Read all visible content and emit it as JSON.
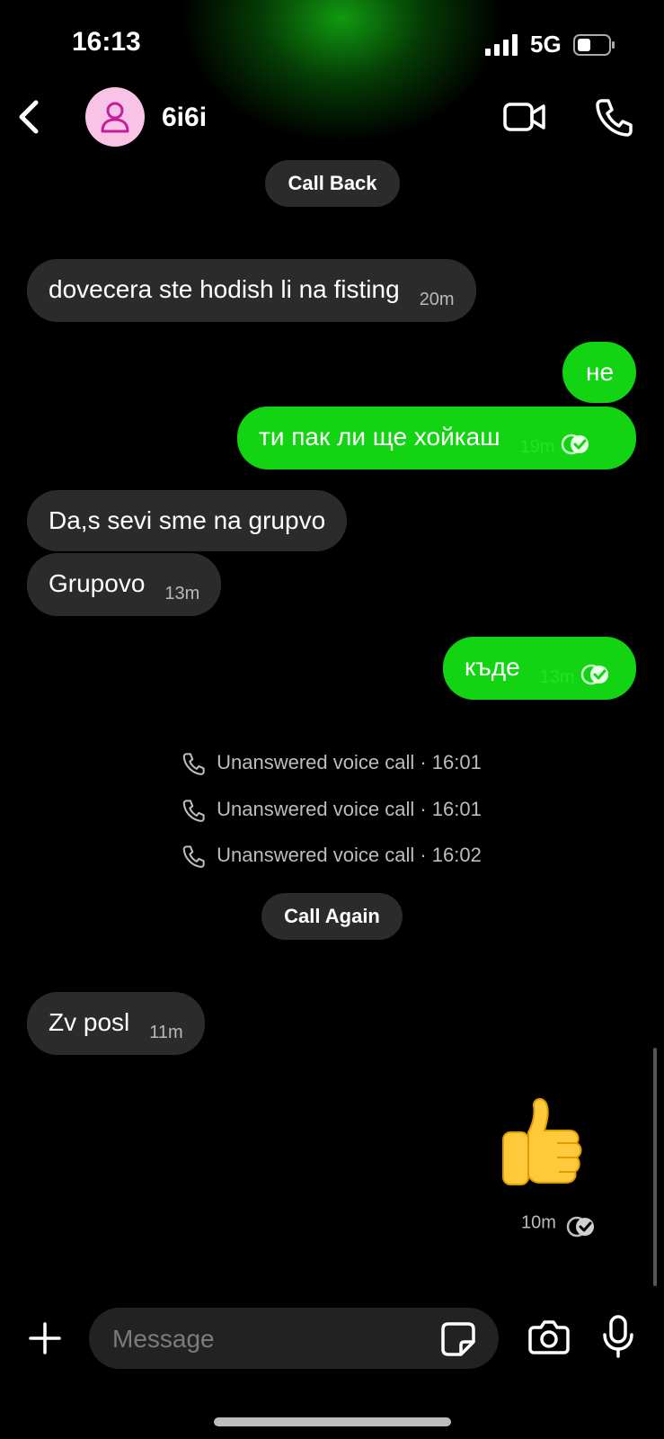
{
  "status_bar": {
    "time": "16:13",
    "network": "5G"
  },
  "header": {
    "contact_name": "6i6i"
  },
  "actions": {
    "call_back": "Call Back",
    "call_again": "Call Again"
  },
  "messages": [
    {
      "direction": "incoming",
      "text": "dovecera ste hodish li na fisting",
      "time": "20m"
    },
    {
      "direction": "outgoing",
      "text": "не",
      "time": ""
    },
    {
      "direction": "outgoing",
      "text": "ти пак ли ще хойкаш",
      "time": "19m",
      "read": true
    },
    {
      "direction": "incoming",
      "text": "Da,s sevi sme na grupvo",
      "time": ""
    },
    {
      "direction": "incoming",
      "text": "Grupovo",
      "time": "13m"
    },
    {
      "direction": "outgoing",
      "text": "къде",
      "time": "13m",
      "read": true
    },
    {
      "direction": "incoming",
      "text": "Zv posl",
      "time": "11m"
    }
  ],
  "call_log": [
    {
      "text": "Unanswered voice call · 16:01"
    },
    {
      "text": "Unanswered voice call · 16:01"
    },
    {
      "text": "Unanswered voice call · 16:02"
    }
  ],
  "reaction": {
    "emoji": "thumbs-up",
    "time": "10m"
  },
  "composer": {
    "placeholder": "Message"
  },
  "colors": {
    "outgoing_bubble": "#13d413",
    "incoming_bubble": "#2b2b2b",
    "background": "#000000",
    "avatar_bg": "#f9c3e8",
    "avatar_icon": "#c41e9e"
  },
  "icons": [
    "back-icon",
    "user-icon",
    "video-icon",
    "phone-icon",
    "plus-icon",
    "sticker-icon",
    "camera-icon",
    "mic-icon",
    "read-check-icon",
    "thumbs-up-icon"
  ]
}
